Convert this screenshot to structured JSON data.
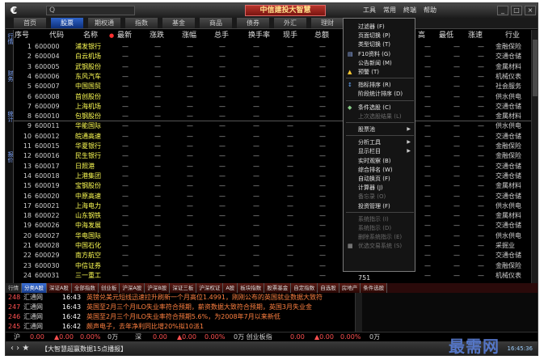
{
  "titlebar": {
    "brand": "中信建投大智慧",
    "menu": [
      "工具",
      "常用",
      "終端",
      "帮助"
    ]
  },
  "nav_tabs": [
    {
      "label": "首页",
      "active": false
    },
    {
      "label": "股票",
      "active": true
    },
    {
      "label": "期权通",
      "active": false
    },
    {
      "label": "指数",
      "active": false
    },
    {
      "label": "基金",
      "active": false
    },
    {
      "label": "商品",
      "active": false
    },
    {
      "label": "债券",
      "active": false
    },
    {
      "label": "外汇",
      "active": false
    },
    {
      "label": "理财",
      "active": false
    },
    {
      "label": "资讯",
      "active": false
    }
  ],
  "left_vtabs": [
    "行情",
    "财务",
    "统计",
    "报价"
  ],
  "table": {
    "headers": [
      "序号",
      "代码",
      "名称",
      "最新",
      "涨跌",
      "涨幅",
      "总手",
      "换手率",
      "现手",
      "总额",
      "高",
      "最低",
      "涨速",
      "行业"
    ],
    "dash": "—",
    "rows": [
      {
        "idx": "1",
        "code": "600000",
        "name": "浦发银行",
        "industry": "金融保险"
      },
      {
        "idx": "2",
        "code": "600004",
        "name": "白云机场",
        "industry": "交通仓储"
      },
      {
        "idx": "3",
        "code": "600005",
        "name": "武钢股份",
        "industry": "金属材料"
      },
      {
        "idx": "4",
        "code": "600006",
        "name": "东风汽车",
        "industry": "机械仪表"
      },
      {
        "idx": "5",
        "code": "600007",
        "name": "中国国贸",
        "industry": "社会服务"
      },
      {
        "idx": "6",
        "code": "600008",
        "name": "首创股份",
        "industry": "供水供电"
      },
      {
        "idx": "7",
        "code": "600009",
        "name": "上海机场",
        "industry": "交通仓储"
      },
      {
        "idx": "8",
        "code": "600010",
        "name": "包钢股份",
        "industry": "金属材料"
      },
      {
        "idx": "9",
        "code": "600011",
        "name": "华能国际",
        "industry": "供水供电"
      },
      {
        "idx": "10",
        "code": "600012",
        "name": "皖通高速",
        "industry": "交通仓储"
      },
      {
        "idx": "11",
        "code": "600015",
        "name": "华夏银行",
        "industry": "金融保险"
      },
      {
        "idx": "12",
        "code": "600016",
        "name": "民生银行",
        "industry": "金融保险"
      },
      {
        "idx": "13",
        "code": "600017",
        "name": "日照港",
        "industry": "交通仓储"
      },
      {
        "idx": "14",
        "code": "600018",
        "name": "上港集团",
        "industry": "交通仓储"
      },
      {
        "idx": "15",
        "code": "600019",
        "name": "宝钢股份",
        "industry": "金属材料"
      },
      {
        "idx": "16",
        "code": "600020",
        "name": "中原高速",
        "industry": "交通仓储"
      },
      {
        "idx": "17",
        "code": "600021",
        "name": "上海电力",
        "industry": "供水供电"
      },
      {
        "idx": "18",
        "code": "600022",
        "name": "山东钢铁",
        "industry": "金属材料"
      },
      {
        "idx": "19",
        "code": "600026",
        "name": "中海发展",
        "industry": "交通仓储"
      },
      {
        "idx": "20",
        "code": "600027",
        "name": "华电国际",
        "industry": "供水供电"
      },
      {
        "idx": "21",
        "code": "600028",
        "name": "中国石化",
        "industry": "采掘业"
      },
      {
        "idx": "22",
        "code": "600029",
        "name": "南方航空",
        "industry": "交通仓储"
      },
      {
        "idx": "23",
        "code": "600030",
        "name": "中信证券",
        "industry": "金融保险"
      },
      {
        "idx": "24",
        "code": "600031",
        "name": "三一重工",
        "industry": "机械仪表"
      }
    ],
    "extra_value": "751"
  },
  "context_menu": {
    "items": [
      {
        "label": "过滤器 (F)",
        "disabled": false,
        "submenu": false,
        "icon": ""
      },
      {
        "label": "页面切换 (P)",
        "disabled": false,
        "submenu": false,
        "icon": ""
      },
      {
        "label": "类型切换 (T)",
        "disabled": false,
        "submenu": false,
        "icon": ""
      },
      {
        "label": "F10资料 (G)",
        "disabled": false,
        "submenu": false,
        "icon": "doc-icon"
      },
      {
        "label": "公告新闻 (M)",
        "disabled": false,
        "submenu": false,
        "icon": ""
      },
      {
        "label": "预警 (T)",
        "disabled": false,
        "submenu": false,
        "icon": "warning-icon"
      },
      {
        "sep": true
      },
      {
        "label": "指标排序 (R)",
        "disabled": false,
        "submenu": false,
        "icon": "sort-icon"
      },
      {
        "label": "阶段统计排序 (D)",
        "disabled": false,
        "submenu": false,
        "icon": ""
      },
      {
        "sep": true
      },
      {
        "label": "条件选股 (C)",
        "disabled": false,
        "submenu": false,
        "icon": "filter-icon"
      },
      {
        "label": "上次选股结果 (L)",
        "disabled": true,
        "submenu": false,
        "icon": ""
      },
      {
        "sep": true
      },
      {
        "label": "股票池",
        "disabled": false,
        "submenu": true,
        "icon": ""
      },
      {
        "sep": true
      },
      {
        "label": "分析工具",
        "disabled": false,
        "submenu": true,
        "icon": ""
      },
      {
        "label": "显示栏目",
        "disabled": false,
        "submenu": true,
        "icon": ""
      },
      {
        "label": "实时观察 (B)",
        "disabled": false,
        "submenu": false,
        "icon": ""
      },
      {
        "label": "综合排名 (W)",
        "disabled": false,
        "submenu": false,
        "icon": ""
      },
      {
        "label": "自动换页 (F)",
        "disabled": false,
        "submenu": false,
        "icon": ""
      },
      {
        "label": "计算器 (J)",
        "disabled": false,
        "submenu": false,
        "icon": ""
      },
      {
        "label": "备忘录 (O)",
        "disabled": true,
        "submenu": false,
        "icon": ""
      },
      {
        "label": "投资管理 (F)",
        "disabled": false,
        "submenu": false,
        "icon": ""
      },
      {
        "sep": true
      },
      {
        "label": "系统指示 (I)",
        "disabled": true,
        "submenu": false,
        "icon": ""
      },
      {
        "label": "系统指示 (D)",
        "disabled": true,
        "submenu": false,
        "icon": ""
      },
      {
        "label": "删除系统指示 (E)",
        "disabled": true,
        "submenu": false,
        "icon": ""
      },
      {
        "label": "优选交易系统 (S)",
        "disabled": true,
        "submenu": false,
        "icon": "grid-icon"
      }
    ]
  },
  "category_tabs": [
    {
      "label": "行情",
      "active": false,
      "first": true
    },
    {
      "label": "分类A股",
      "active": true
    },
    {
      "label": "深证A股",
      "active": false
    },
    {
      "label": "全部指数",
      "active": false
    },
    {
      "label": "创业板",
      "active": false
    },
    {
      "label": "沪深A股",
      "active": false
    },
    {
      "label": "沪深B股",
      "active": false
    },
    {
      "label": "深证三板",
      "active": false
    },
    {
      "label": "沪深权证",
      "active": false
    },
    {
      "label": "A股",
      "active": false
    },
    {
      "label": "板块指数",
      "active": false
    },
    {
      "label": "股票基金",
      "active": false
    },
    {
      "label": "自定指数",
      "active": false
    },
    {
      "label": "自选股",
      "active": false
    },
    {
      "label": "房地产",
      "active": false
    },
    {
      "label": "条件选股",
      "active": false
    }
  ],
  "news": [
    {
      "id": "248",
      "name": "汇通网",
      "time": "16:43",
      "text": "英镑兑美元短线迅速拉升刷新一个月高位1.4991，刚刚公布的英国就业数据大致符"
    },
    {
      "id": "247",
      "name": "汇通网",
      "time": "16:43",
      "text": "英国至2月三个月ILO失业率符合预期，薪资数据大致符合预期，英国3月失业金"
    },
    {
      "id": "246",
      "name": "汇通网",
      "time": "16:42",
      "text": "英国至2月三个月ILO失业率符合预期5.6%，为2008年7月以来新低"
    },
    {
      "id": "245",
      "name": "汇通网",
      "time": "16:42",
      "text": "颇声电子，去年净利同比增20%拟10派1"
    }
  ],
  "index_bar": [
    {
      "text": "沪",
      "color": "#d0d0d0"
    },
    {
      "text": "0.00",
      "color": "#ff5050"
    },
    {
      "text": "▲0.00",
      "color": "#ff5050"
    },
    {
      "text": "0.00%",
      "color": "#ff5050"
    },
    {
      "text": "0万",
      "color": "#d0d0d0"
    },
    {
      "text": "深",
      "color": "#d0d0d0"
    },
    {
      "text": "0.00",
      "color": "#ff5050"
    },
    {
      "text": "▲0.00",
      "color": "#ff5050"
    },
    {
      "text": "0.00%",
      "color": "#ff5050"
    },
    {
      "text": "0万 创业板指",
      "color": "#d0d0d0"
    },
    {
      "text": "0.00",
      "color": "#ff5050"
    },
    {
      "text": "▲0.00",
      "color": "#ff5050"
    },
    {
      "text": "0.00%",
      "color": "#ff5050"
    },
    {
      "text": "0万",
      "color": "#d0d0d0"
    }
  ],
  "statusbar": {
    "message": "【大智慧超赢数据15点播报】",
    "watermark": "最需网",
    "clock": "16:45:36"
  }
}
